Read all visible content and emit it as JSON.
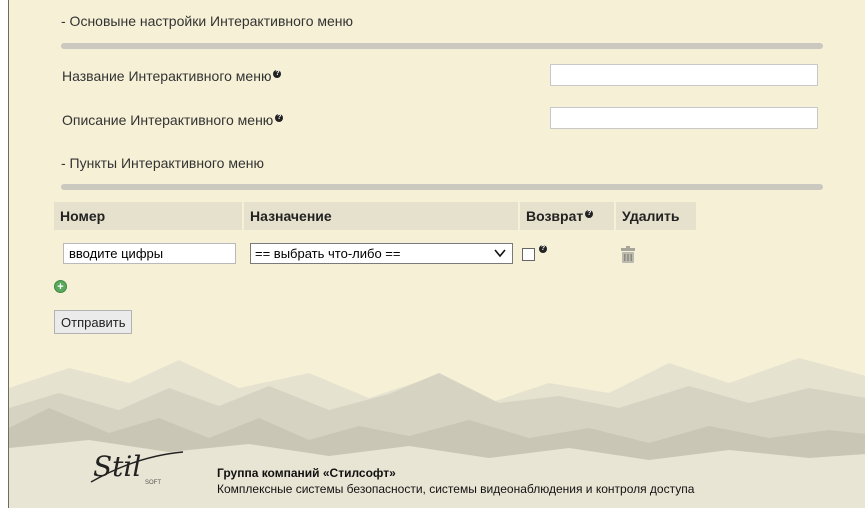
{
  "basic_section": {
    "title": "- Основыне настройки Интерактивного меню"
  },
  "fields": {
    "name_label": "Название Интерактивного меню",
    "name_value": "",
    "desc_label": "Описание Интерактивного меню",
    "desc_value": ""
  },
  "items_section": {
    "title": "- Пункты Интерактивного меню"
  },
  "table": {
    "headers": {
      "number": "Номер",
      "purpose": "Назначение",
      "return": "Возврат",
      "delete": "Удалить"
    },
    "row": {
      "number_value": "вводите цифры",
      "purpose_selected": "== выбрать что-либо ==",
      "return_checked": false
    }
  },
  "submit_label": "Отправить",
  "footer": {
    "logo_text": "Stil",
    "logo_sub": "SOFT",
    "company": "Группа компаний «Стилсофт»",
    "description": "Комплексные системы безопасности, системы видеонаблюдения и контроля доступа"
  },
  "colors": {
    "background": "#f5f0d6",
    "header_bg": "#e6e1cd",
    "rule": "#cac8bf",
    "add_icon": "#5ba95c"
  },
  "icons": {
    "help": "question-icon",
    "add": "plus-circle-icon",
    "delete": "trash-icon",
    "select": "chevron-down-icon"
  }
}
